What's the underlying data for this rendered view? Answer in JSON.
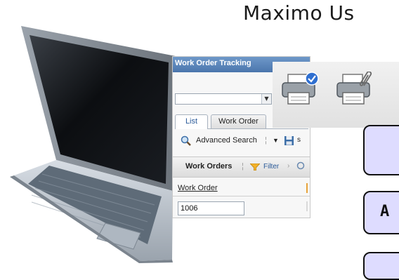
{
  "title": "Maximo Us",
  "panel": {
    "header": "Work Order Tracking",
    "tabs": [
      "List",
      "Work Order"
    ],
    "toolbar": {
      "advanced_search": "Advanced Search"
    },
    "subheader": {
      "label": "Work Orders",
      "filter": "Filter"
    },
    "column_header": "Work Order",
    "row_value": "1006"
  },
  "side_buttons": [
    {
      "label": ""
    },
    {
      "label": "A"
    },
    {
      "label": ""
    }
  ]
}
